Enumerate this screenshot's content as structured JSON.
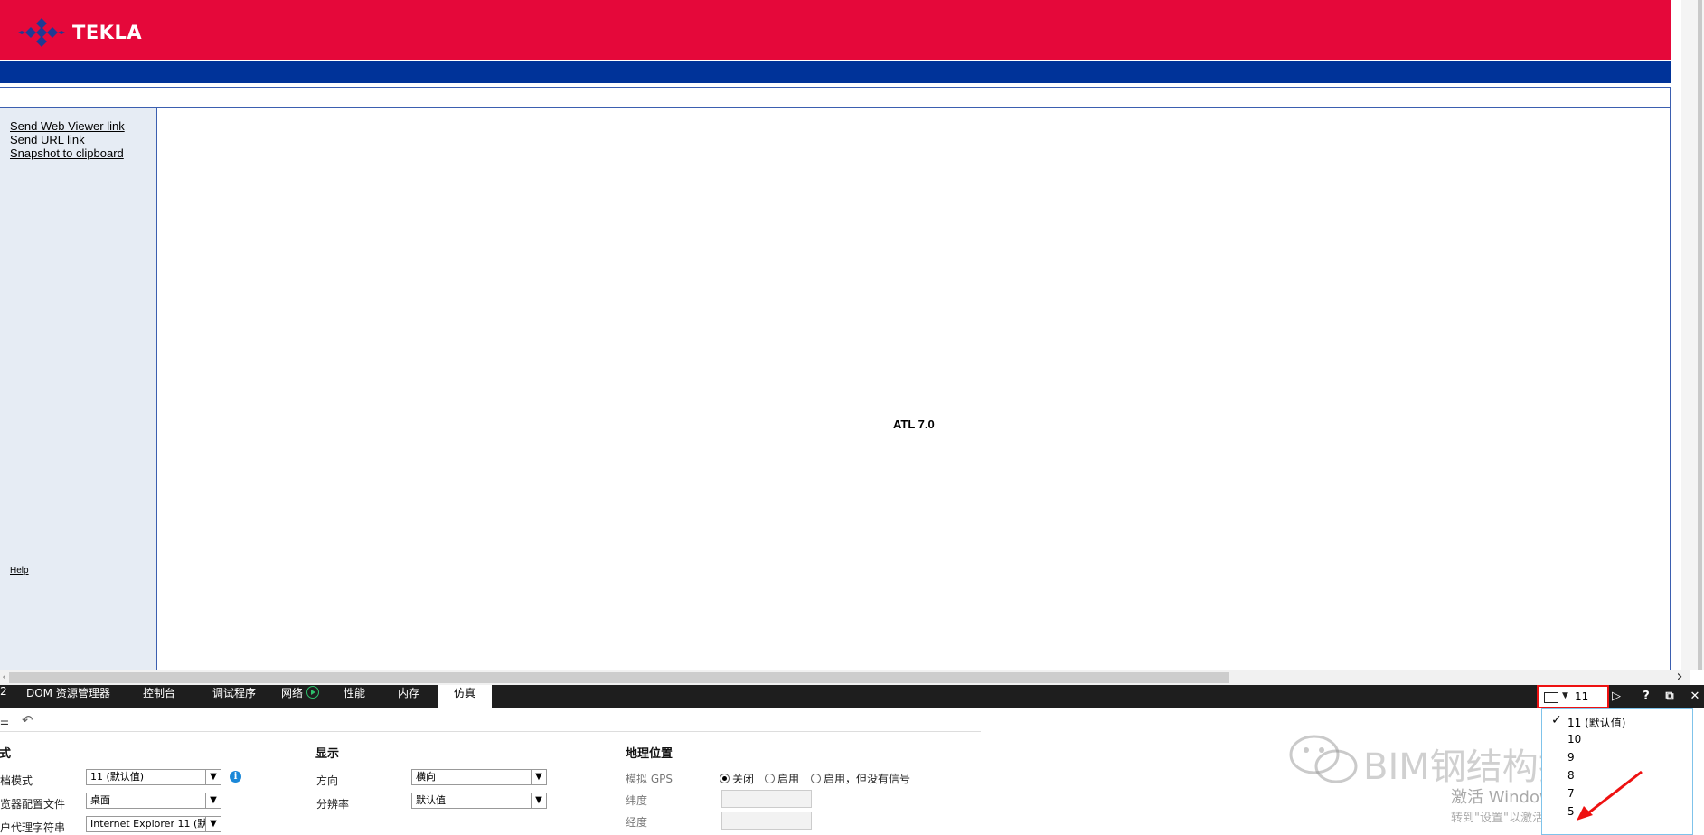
{
  "header": {
    "brand": "TEKLA"
  },
  "sidebar": {
    "links": [
      "Send Web Viewer link",
      "Send URL link",
      "Snapshot to clipboard"
    ],
    "help": "Help"
  },
  "content": {
    "text": "ATL 7.0"
  },
  "devtools": {
    "tabs": [
      "2",
      "DOM 资源管理器",
      "控制台",
      "调试程序",
      "网络",
      "性能",
      "内存",
      "仿真"
    ],
    "active_tab": "仿真",
    "doc_mode_value": "11",
    "buttons": {
      "console": "▷",
      "help": "?",
      "undock": "⧉",
      "close": "✕"
    }
  },
  "emulation": {
    "mode": {
      "title": "模式",
      "doc_mode_label": "文档模式",
      "doc_mode_value": "11 (默认值)",
      "browser_profile_label": "浏览器配置文件",
      "browser_profile_value": "桌面",
      "user_agent_label": "用户代理字符串",
      "user_agent_value": "Internet Explorer 11 (默"
    },
    "display": {
      "title": "显示",
      "orientation_label": "方向",
      "orientation_value": "横向",
      "resolution_label": "分辨率",
      "resolution_value": "默认值"
    },
    "geo": {
      "title": "地理位置",
      "gps_label": "模拟 GPS",
      "options": [
        "关闭",
        "启用",
        "启用，但没有信号"
      ],
      "selected": "关闭",
      "latitude_label": "纬度",
      "longitude_label": "经度"
    }
  },
  "dropdown": {
    "items": [
      "11 (默认值)",
      "10",
      "9",
      "8",
      "7",
      "5"
    ],
    "selected": "11 (默认值)"
  },
  "watermark": {
    "brand": "BIM钢结构技术",
    "activate_title": "激活 Windows",
    "activate_sub": "转到\"设置\"以激活 Windows。"
  },
  "colors": {
    "header_red": "#e5083a",
    "nav_blue": "#003399",
    "highlight": "#ee1111"
  }
}
